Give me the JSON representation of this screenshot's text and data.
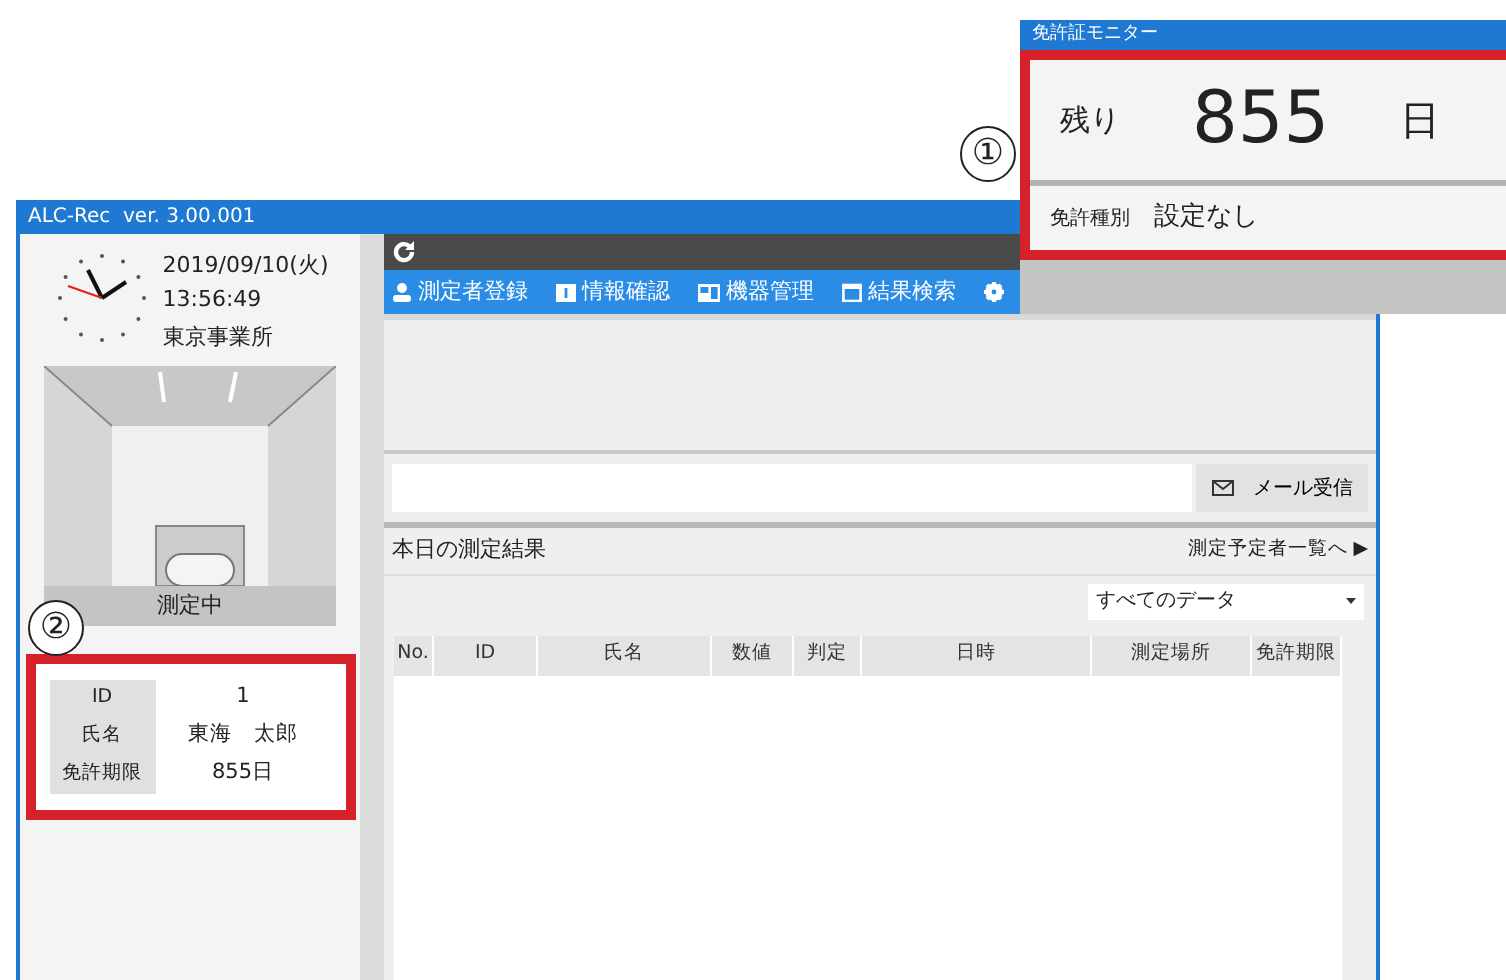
{
  "main_window": {
    "title": "ALC-Rec  ver. 3.00.001",
    "side_panel": {
      "date": "2019/09/10(火)",
      "time": "13:56:49",
      "office": "東京事業所",
      "camera_status": "測定中",
      "info_highlighted": true,
      "info_rows": [
        {
          "label": "ID",
          "value": "1"
        },
        {
          "label": "氏名",
          "value": "東海　太郎"
        },
        {
          "label": "免許期限",
          "value": "855日"
        }
      ]
    },
    "nav": [
      {
        "kind": "person",
        "label": "測定者登録"
      },
      {
        "kind": "card",
        "label": "情報確認"
      },
      {
        "kind": "device",
        "label": "機器管理"
      },
      {
        "kind": "calendar",
        "label": "結果検索"
      },
      {
        "kind": "gear"
      }
    ],
    "mail_button": "メール受信",
    "results": {
      "title": "本日の測定結果",
      "link": "測定予定者一覧へ",
      "link_arrow": "▶",
      "filter": "すべてのデータ",
      "columns": [
        "No.",
        "ID",
        "氏名",
        "数値",
        "判定",
        "日時",
        "測定場所",
        "免許期限"
      ]
    }
  },
  "license_monitor": {
    "title": "免許証モニター",
    "highlighted": true,
    "remaining_label": "残り",
    "remaining_value": "855",
    "unit": "日",
    "type_label": "免許種別",
    "type_value": "設定なし"
  },
  "annotations": [
    {
      "label": "①"
    },
    {
      "label": "②"
    }
  ]
}
